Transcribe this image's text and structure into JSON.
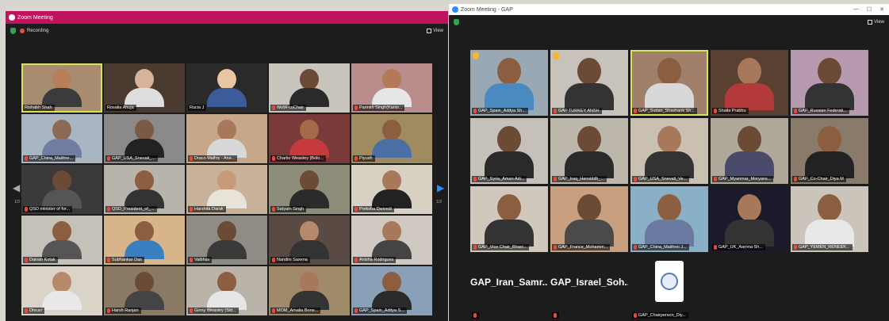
{
  "left_window": {
    "title": "Zoom Meeting",
    "recording_label": "Recording",
    "view_label": "View",
    "page_left": "1/3",
    "page_right": "1/3",
    "participants": [
      {
        "name": "Rishabh Shah",
        "bg": "#a88c70",
        "skin": "#b57f5a",
        "shirt": "#3b3b3b",
        "active": true,
        "muted": false
      },
      {
        "name": "Rosalia Ahuja",
        "bg": "#4a3a30",
        "skin": "#d8b39a",
        "shirt": "#dddddd",
        "active": false,
        "muted": false
      },
      {
        "name": "Rucia J",
        "bg": "#2a2a2a",
        "skin": "#e7c6a0",
        "shirt": "#3b5b9b",
        "active": false,
        "muted": false
      },
      {
        "name": "WoW-coChair",
        "bg": "#c9c5bd",
        "skin": "#6b4a36",
        "shirt": "#2a2a2a",
        "active": false,
        "muted": true
      },
      {
        "name": "Parinith Singh(Kanis...",
        "bg": "#b98d8b",
        "skin": "#b37a57",
        "shirt": "#e6e6e6",
        "active": false,
        "muted": true
      },
      {
        "name": "GAP_China_Maithre...",
        "bg": "#a9b6c2",
        "skin": "#8d6a55",
        "shirt": "#6f7ea0",
        "active": false,
        "muted": true
      },
      {
        "name": "GAP_USA_Snevali_...",
        "bg": "#8a8a8a",
        "skin": "#7a5a44",
        "shirt": "#222222",
        "active": false,
        "muted": true
      },
      {
        "name": "Draco Malfoy - Ane...",
        "bg": "#c7a789",
        "skin": "#a8785a",
        "shirt": "#d8d8d8",
        "active": false,
        "muted": true
      },
      {
        "name": "Charlie Weasley (Bolo...",
        "bg": "#7a3a3a",
        "skin": "#a36a4a",
        "shirt": "#c53a3a",
        "active": false,
        "muted": true
      },
      {
        "name": "Piyush",
        "bg": "#a08a60",
        "skin": "#8a5e3f",
        "shirt": "#4a6fa5",
        "active": false,
        "muted": true
      },
      {
        "name": "QSD minister of for...",
        "bg": "#3a3a3a",
        "skin": "#6b4a36",
        "shirt": "#555555",
        "active": false,
        "muted": true
      },
      {
        "name": "QSD_President_of_...",
        "bg": "#b8b4ac",
        "skin": "#8a5e3f",
        "shirt": "#333333",
        "active": false,
        "muted": true
      },
      {
        "name": "Harshita Darak",
        "bg": "#c9b29a",
        "skin": "#c79a7a",
        "shirt": "#e8e3d8",
        "active": false,
        "muted": true
      },
      {
        "name": "Satyam Singh",
        "bg": "#8d8d7a",
        "skin": "#6b4a36",
        "shirt": "#2b2b2b",
        "active": false,
        "muted": true
      },
      {
        "name": "Preksha Dwivedi",
        "bg": "#d9d0c4",
        "skin": "#a8785a",
        "shirt": "#222222",
        "active": false,
        "muted": true
      },
      {
        "name": "Daivan Kotak",
        "bg": "#c5c1b9",
        "skin": "#8a5e3f",
        "shirt": "#555555",
        "active": false,
        "muted": true
      },
      {
        "name": "Subhankar Das",
        "bg": "#d8b48a",
        "skin": "#8a5e3f",
        "shirt": "#3a7fc0",
        "active": false,
        "muted": true
      },
      {
        "name": "Vaibhav",
        "bg": "#8f8b85",
        "skin": "#6b4a36",
        "shirt": "#3a3a3a",
        "active": false,
        "muted": true
      },
      {
        "name": "Nandini Saxena",
        "bg": "#5a4a44",
        "skin": "#b58a6a",
        "shirt": "#333333",
        "active": false,
        "muted": true
      },
      {
        "name": "Anisha Rodrigues",
        "bg": "#cfc9c1",
        "skin": "#a8785a",
        "shirt": "#444444",
        "active": false,
        "muted": true
      },
      {
        "name": "Dhruvi",
        "bg": "#d9d3c8",
        "skin": "#b58a6a",
        "shirt": "#e8e8e8",
        "active": false,
        "muted": true
      },
      {
        "name": "Harsh Ranjan",
        "bg": "#8a7a64",
        "skin": "#6b4a36",
        "shirt": "#444444",
        "active": false,
        "muted": true
      },
      {
        "name": "Ginny Weasley (Sid...",
        "bg": "#b9b3a9",
        "skin": "#8a5e3f",
        "shirt": "#e6e6e6",
        "active": false,
        "muted": true
      },
      {
        "name": "MOM_Amalia Bone...",
        "bg": "#a08a6a",
        "skin": "#a8785a",
        "shirt": "#333333",
        "active": false,
        "muted": true
      },
      {
        "name": "GAP_Spain_Aditya S...",
        "bg": "#8aa0b8",
        "skin": "#8a5e3f",
        "shirt": "#2a2a2a",
        "active": false,
        "muted": true
      }
    ]
  },
  "right_window": {
    "title": "Zoom Meeting - GAP",
    "view_label": "View",
    "participants": [
      {
        "name": "GAP_Spain_Aditya Sh...",
        "bg": "#9aa8b4",
        "skin": "#8a5e3f",
        "shirt": "#4a8ac0",
        "active": false,
        "hand": true,
        "type": "video"
      },
      {
        "name": "GAP TURKEY ANSH",
        "bg": "#c7c3bb",
        "skin": "#6b4a36",
        "shirt": "#333333",
        "active": false,
        "hand": true,
        "type": "video"
      },
      {
        "name": "GAP_Sudan_Shashank Sh...",
        "bg": "#a0806a",
        "skin": "#8a5e3f",
        "shirt": "#d8d8d8",
        "active": true,
        "hand": false,
        "type": "video"
      },
      {
        "name": "Shaila Prabhu",
        "bg": "#5a4030",
        "skin": "#a8785a",
        "shirt": "#b23a3a",
        "active": false,
        "hand": false,
        "type": "video"
      },
      {
        "name": "GAP_Russian Federati...",
        "bg": "#b89ab0",
        "skin": "#6b4a36",
        "shirt": "#333333",
        "active": false,
        "hand": false,
        "type": "video"
      },
      {
        "name": "GAP_Syria_Aman Adi...",
        "bg": "#c5c1b9",
        "skin": "#6b4a36",
        "shirt": "#2a2a2a",
        "active": false,
        "hand": false,
        "type": "video"
      },
      {
        "name": "GAP_Iraq_Hansiddh_...",
        "bg": "#bdb6aa",
        "skin": "#6b4a36",
        "shirt": "#2a2a2a",
        "active": false,
        "hand": false,
        "type": "video"
      },
      {
        "name": "GAP_USA_Snevali_Ve...",
        "bg": "#c9c0b2",
        "skin": "#a8785a",
        "shirt": "#333333",
        "active": false,
        "hand": false,
        "type": "video"
      },
      {
        "name": "GAP_Myanmar_Moryans...",
        "bg": "#b0a89a",
        "skin": "#6b4a36",
        "shirt": "#4a4a6a",
        "active": false,
        "hand": false,
        "type": "video"
      },
      {
        "name": "GAP_Co-Chair_Diya M",
        "bg": "#8a7a6a",
        "skin": "#8a5e3f",
        "shirt": "#222222",
        "active": false,
        "hand": false,
        "type": "video"
      },
      {
        "name": "GAP_Vice Chair_Bhavi...",
        "bg": "#d0c8bc",
        "skin": "#8a5e3f",
        "shirt": "#333333",
        "active": false,
        "hand": false,
        "type": "video"
      },
      {
        "name": "GAP_France_Mohamm...",
        "bg": "#c8a080",
        "skin": "#6b4a36",
        "shirt": "#4a4a4a",
        "active": false,
        "hand": false,
        "type": "video"
      },
      {
        "name": "GAP_China_Maithrei J...",
        "bg": "#8ab0c8",
        "skin": "#8a5e3f",
        "shirt": "#6a7aa0",
        "active": false,
        "hand": false,
        "type": "video"
      },
      {
        "name": "GAP_UK_Aarnna Sh...",
        "bg": "#1a1a2a",
        "skin": "#a8785a",
        "shirt": "#333333",
        "active": false,
        "hand": false,
        "type": "video"
      },
      {
        "name": "GAP_YEMEN_RENEEK...",
        "bg": "#cac4ba",
        "skin": "#8a5e3f",
        "shirt": "#e8e8e8",
        "active": false,
        "hand": false,
        "type": "video"
      },
      {
        "name": "GAP_Iran_Samr...",
        "bg": "#1c1c1c",
        "active": false,
        "hand": false,
        "type": "name"
      },
      {
        "name": "GAP_Israel_Soh...",
        "bg": "#1c1c1c",
        "active": false,
        "hand": false,
        "type": "name"
      },
      {
        "name": "GAP_Chairperson_Diy...",
        "bg": "#1c1c1c",
        "active": false,
        "hand": false,
        "type": "logo"
      }
    ]
  }
}
